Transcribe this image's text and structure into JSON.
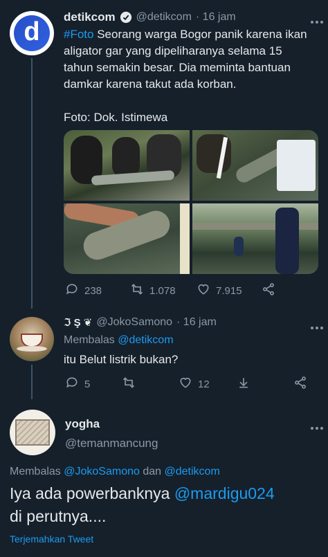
{
  "tweet1": {
    "display_name": "detikcom",
    "handle": "@detikcom",
    "time": "· 16 jam",
    "hashtag": "#Foto",
    "text_rest": " Seorang warga Bogor panik karena ikan\naligator gar yang dipeliharanya selama 15\ntahun semakin besar. Dia meminta bantuan\ndamkar karena takut ada korban.\n\nFoto: Dok. Istimewa",
    "replies": "238",
    "retweets": "1.078",
    "likes": "7.915",
    "avatar_letter": "d"
  },
  "tweet2": {
    "display_name": "ℑ Ş ❦",
    "handle": "@JokoSamono",
    "time": "· 16 jam",
    "replying_label": "Membalas",
    "replying_to": "@detikcom",
    "text": "itu Belut listrik bukan?",
    "replies": "5",
    "likes": "12"
  },
  "tweet3": {
    "display_name": "yogha",
    "handle": "@temanmancung",
    "replying_label": "Membalas",
    "replying_to_1": "@JokoSamono",
    "replying_and": "dan",
    "replying_to_2": "@detikcom",
    "text_line1_a": "Iya ada powerbanknya",
    "mention": "@mardigu024",
    "text_line2": "di perutnya....",
    "translate": "Terjemahkan Tweet"
  },
  "colors": {
    "background": "#15202b",
    "accent": "#1d9bf0",
    "muted": "#8b98a5",
    "divider": "#38444d"
  }
}
